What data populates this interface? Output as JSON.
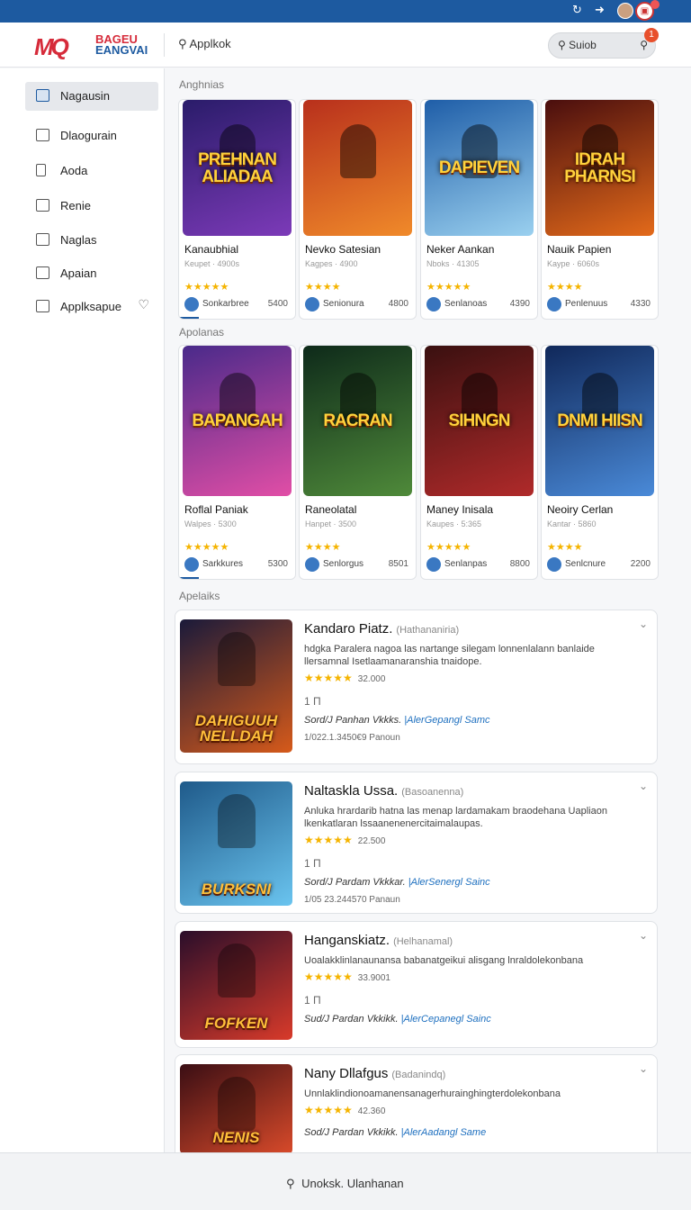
{
  "header": {
    "logo_mark": "MQ",
    "logo_line1": "BAGEU",
    "logo_line2": "EANGVAI",
    "search_label": "Applkok",
    "pill_label": "Suiob",
    "pill_badge": "1",
    "search_icon": "search-icon"
  },
  "sidebar": {
    "items": [
      {
        "label": "Nagausin",
        "icon": "list-icon"
      },
      {
        "label": "Dlaogurain",
        "icon": "square-icon"
      },
      {
        "label": "Aoda",
        "icon": "book-icon"
      },
      {
        "label": "Renie",
        "icon": "share-icon"
      },
      {
        "label": "Naglas",
        "icon": "square-icon"
      },
      {
        "label": "Apaian",
        "icon": "gamepad-icon"
      },
      {
        "label": "Applksapue",
        "icon": "square-icon"
      }
    ]
  },
  "sections": {
    "first": "Anghnias",
    "second": "Apolanas",
    "third": "Apelaiks"
  },
  "grid1": [
    {
      "art": "PREHNAN ALIADAA",
      "name": "Kanaubhial",
      "sub": "Keupet · 4900s",
      "stars": "★★★★★",
      "dev": "Sonkarbree",
      "count": "5400",
      "colors": [
        "#2a1c6a",
        "#7c3ab8"
      ]
    },
    {
      "art": "",
      "name": "Nevko Satesian",
      "sub": "Kagpes · 4900",
      "stars": "★★★★",
      "dev": "Senionura",
      "count": "4800",
      "colors": [
        "#b8301c",
        "#f08a2a"
      ]
    },
    {
      "art": "DAPIEVEN",
      "name": "Neker Aankan",
      "sub": "Nboks · 41305",
      "stars": "★★★★★",
      "dev": "Senlanoas",
      "count": "4390",
      "colors": [
        "#1f5ea8",
        "#9ad0ef"
      ]
    },
    {
      "art": "IDRAH PHARNSI",
      "name": "Nauik Papien",
      "sub": "Kaype · 6060s",
      "stars": "★★★★",
      "dev": "Penlenuus",
      "count": "4330",
      "colors": [
        "#4a0e0e",
        "#e36a1a"
      ]
    }
  ],
  "grid2": [
    {
      "art": "BAPANGAH",
      "name": "Roflal Paniak",
      "sub": "Walpes · 5300",
      "stars": "★★★★★",
      "dev": "Sarkkures",
      "count": "5300",
      "colors": [
        "#4a2a8a",
        "#e14ea6"
      ]
    },
    {
      "art": "RACRAN",
      "name": "Raneolatal",
      "sub": "Hanpet · 3500",
      "stars": "★★★★",
      "dev": "Senlorgus",
      "count": "8501",
      "colors": [
        "#0e2a1a",
        "#4f8a3a"
      ]
    },
    {
      "art": "SIHNGN",
      "name": "Maney Inisala",
      "sub": "Kaupes · 5:365",
      "stars": "★★★★★",
      "dev": "Senlanpas",
      "count": "8800",
      "colors": [
        "#3a1010",
        "#b02a2a"
      ]
    },
    {
      "art": "DNMI HIISN",
      "name": "Neoiry Cerlan",
      "sub": "Kantar · 5860",
      "stars": "★★★★",
      "dev": "Senlcnure",
      "count": "2200",
      "colors": [
        "#10285a",
        "#4a8ad8"
      ]
    }
  ],
  "list": [
    {
      "title": "Kandaro Piatz.",
      "tag": "(Hathananiria)",
      "desc": "hdgka Paralera nagoa las nartange silegam lonnenlalann banlaide llersamnal Isetlaamanaranshia tnaidope.",
      "stars": "★★★★★",
      "score": "32.000",
      "mini": "1 Π",
      "meta_a": "Sord/J Panhan Vkkks.",
      "meta_b": "|AlerGepangl Samc",
      "foot": "1/022.1.3450€9 Panoun",
      "art": "DAHIGUUH NELLDAH",
      "colors": [
        "#1a1a3a",
        "#d65a1a"
      ]
    },
    {
      "title": "Naltaskla Ussa.",
      "tag": "(Basoanenna)",
      "desc": "Anluka hrardarib hatna las menap lardamakam braodehana Uapliaon lkenkatlaran lssaanenenercitaimalaupas.",
      "stars": "★★★★★",
      "score": "22.500",
      "mini": "1 Π",
      "meta_a": "Sord/J Pardam Vkkkar.",
      "meta_b": "|AlerSenergl Sainc",
      "foot": "1/05 23.244570 Panaun",
      "art": "BURKSNI",
      "colors": [
        "#1f5a8a",
        "#6ac4ef"
      ]
    },
    {
      "title": "Hanganskiatz.",
      "tag": "(Helhanamal)",
      "desc": "Uoalakklinlanaunansa babanatgeikui alisgang lnraldolekonbana",
      "stars": "★★★★★",
      "score": "33.9001",
      "mini": "1 Π",
      "meta_a": "Sud/J Pardan Vkkikk.",
      "meta_b": "|AlerCepanegl Sainc",
      "foot": "",
      "art": "FOFKEN",
      "colors": [
        "#2a0e2a",
        "#d83a2a"
      ]
    },
    {
      "title": "Nany Dllafgus",
      "tag": "(Badanindq)",
      "desc": "Unnlaklindionoamanensanagerhurainghingterdolekonbana",
      "stars": "★★★★★",
      "score": "42.360",
      "mini": "",
      "meta_a": "Sod/J Pardan Vkkikk.",
      "meta_b": "|AlerAadangl Same",
      "foot": "",
      "art": "NENIS",
      "colors": [
        "#3a0e14",
        "#d84a2a"
      ]
    }
  ],
  "bottombar": {
    "search_label": "Unoksk. Ulanhanan"
  }
}
